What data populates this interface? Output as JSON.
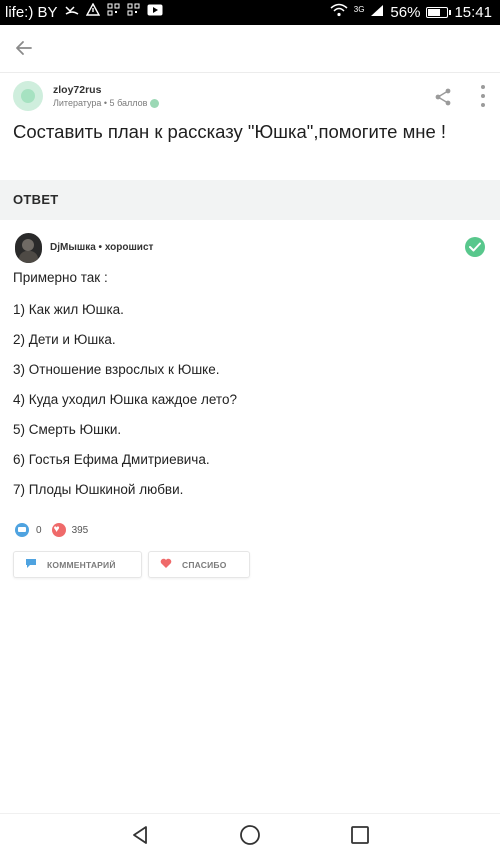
{
  "status_bar": {
    "carrier": "life:) BY",
    "network": "3G",
    "battery_percent": "56%",
    "battery_level": 0.56,
    "time": "15:41"
  },
  "question": {
    "author": "zloy72rus",
    "meta": "Литература • 5 баллов",
    "text": "Составить план к рассказу \"Юшка\",помогите мне !"
  },
  "answer_section": {
    "title": "ОТВЕТ"
  },
  "answer": {
    "author": "DjМышка • хорошист",
    "lines": [
      "Примерно так :",
      "1) Как жил Юшка.",
      "2) Дети и Юшка.",
      "3) Отношение взрослых к Юшке.",
      "4) Куда уходил Юшка каждое лето?",
      "5) Смерть Юшки.",
      "6) Гостья Ефима Дмитриевича.",
      "7) Плоды Юшкиной любви."
    ],
    "comments_count": "0",
    "thanks_count": "395",
    "comment_button": "КОММЕНТАРИЙ",
    "thanks_button": "СПАСИБО"
  },
  "colors": {
    "accent_green": "#58c78c",
    "comment_blue": "#4fa3e0",
    "heart_red": "#ef6a6a"
  },
  "icons": [
    "back-arrow-icon",
    "share-icon",
    "more-vert-icon",
    "verified-check-icon",
    "comment-icon",
    "heart-icon",
    "nav-back-icon",
    "nav-home-icon",
    "nav-recents-icon"
  ]
}
